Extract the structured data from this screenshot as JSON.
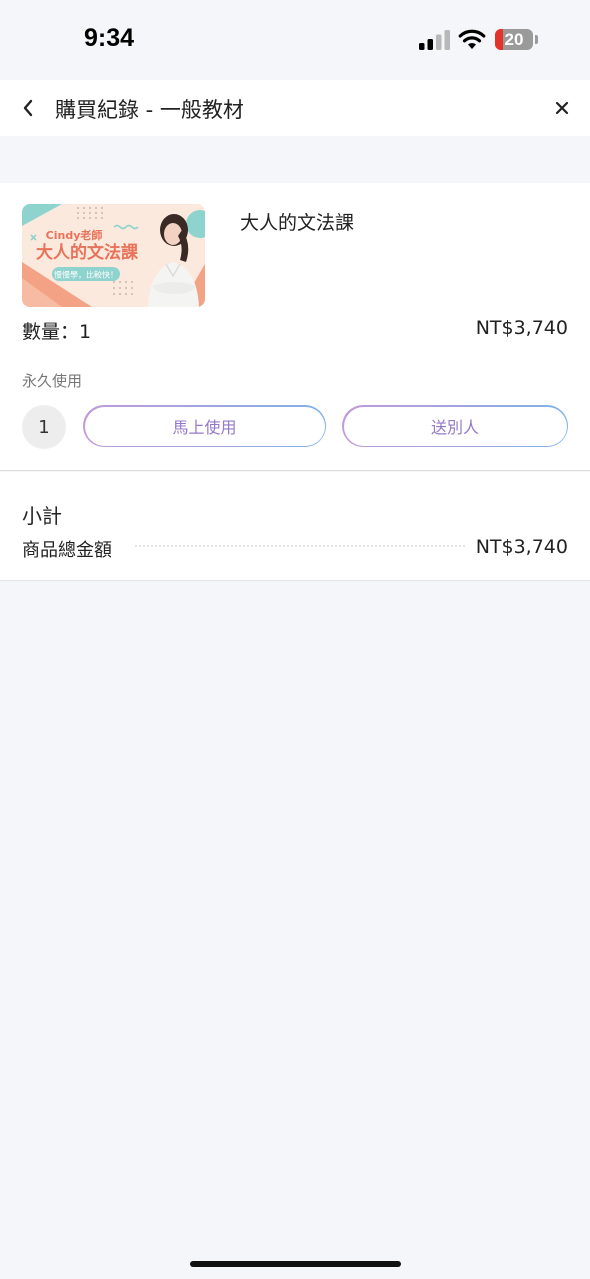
{
  "status_bar": {
    "time": "9:34",
    "battery_level": "20",
    "battery_fraction": 0.2,
    "battery_color": "#e5322b",
    "icons": [
      "cellular-signal-icon",
      "wifi-icon",
      "battery-icon"
    ]
  },
  "nav": {
    "title": "購買紀錄 - 一般教材",
    "back_icon": "chevron-left-icon",
    "close_icon": "close-icon"
  },
  "product": {
    "thumbnail": {
      "teacher": "Cindy老師",
      "course_title": "大人的文法課",
      "slogan": "慢慢學，比較快！"
    },
    "name": "大人的文法課",
    "quantity_label": "數量：1",
    "price": "NT$3,740",
    "validity": "永久使用",
    "count": "1",
    "use_now_label": "馬上使用",
    "gift_label": "送別人"
  },
  "subtotal": {
    "title": "小計",
    "total_label": "商品總金額",
    "total_value": "NT$3,740"
  },
  "colors": {
    "accent_gradient_start": "#c29ad8",
    "accent_gradient_end": "#7fb2ea",
    "button_text": "#9478c8",
    "page_background": "#f5f6fa"
  }
}
